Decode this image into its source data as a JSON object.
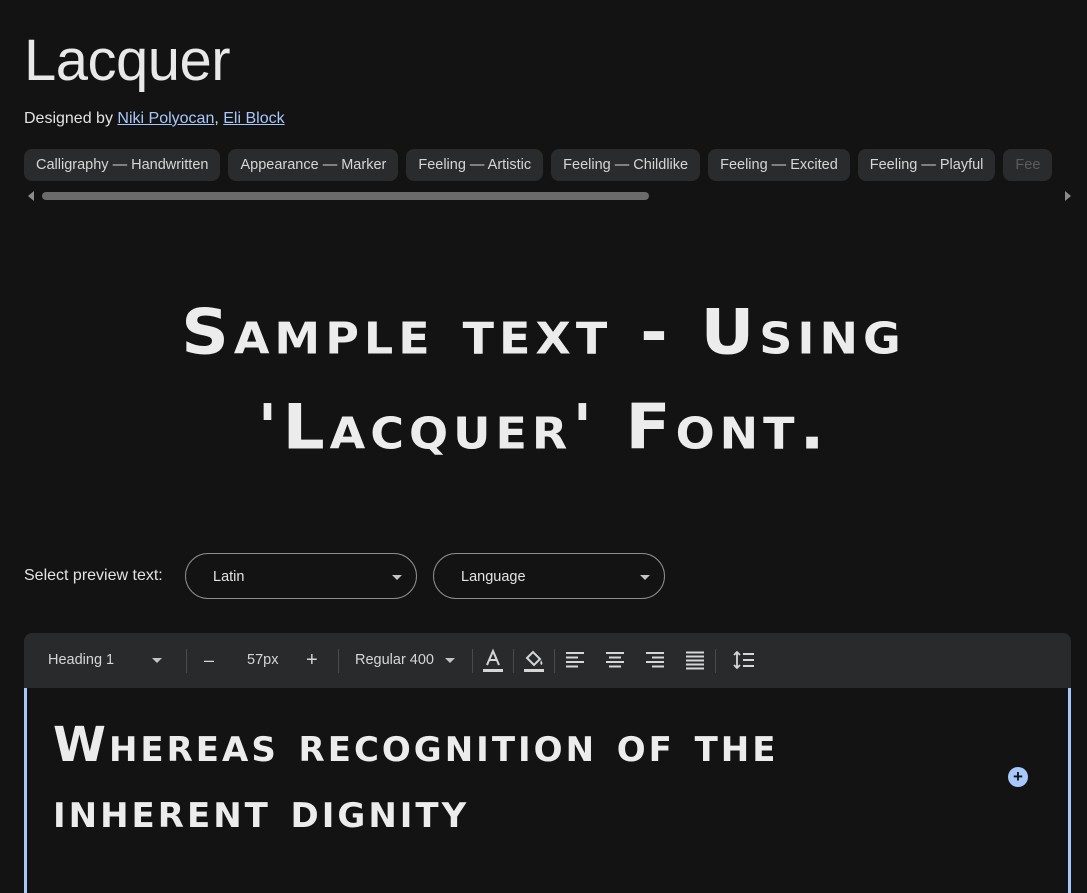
{
  "font": {
    "name": "Lacquer",
    "designed_by_label": "Designed by",
    "designers": [
      "Niki Polyocan",
      "Eli Block"
    ],
    "separator": ","
  },
  "tags": [
    "Calligraphy — Handwritten",
    "Appearance — Marker",
    "Feeling — Artistic",
    "Feeling — Childlike",
    "Feeling — Excited",
    "Feeling — Playful",
    "Fee"
  ],
  "hero_sample": {
    "line1": "Sample text - Using",
    "line2": "'Lacquer' Font."
  },
  "preview": {
    "label": "Select preview text:",
    "script_select": "Latin",
    "language_select": "Language"
  },
  "toolbar": {
    "style_select": "Heading 1",
    "decrease": "–",
    "size": "57px",
    "increase": "+",
    "weight_select": "Regular 400"
  },
  "editor": {
    "text": "Whereas recognition of the inherent dignity"
  },
  "colors": {
    "background": "#131313",
    "toolbar": "#282a2c",
    "chip": "#2a2b2c",
    "link": "#a8c7fa",
    "accent": "#a8c7fa"
  },
  "icons": {
    "text_color": "text-color-icon",
    "highlight": "paint-bucket-icon",
    "align_left": "align-left-icon",
    "align_center": "align-center-icon",
    "align_right": "align-right-icon",
    "align_justify": "align-justify-icon",
    "line_height": "line-height-icon",
    "add": "add-circle-icon"
  }
}
